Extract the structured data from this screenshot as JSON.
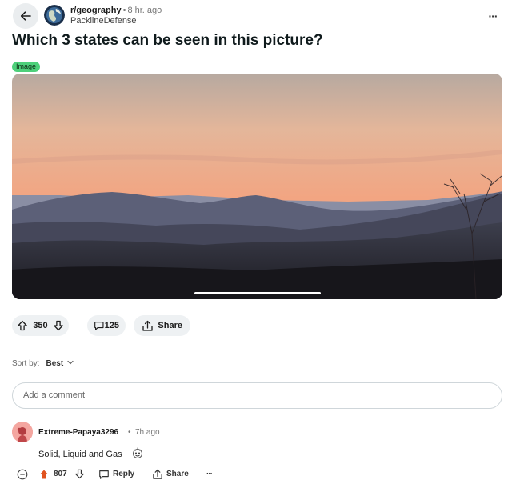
{
  "post": {
    "subreddit": "r/geography",
    "dot": "•",
    "time": "8 hr. ago",
    "author": "PacklineDefense",
    "title": "Which 3 states can be seen in this picture?",
    "flair": "Image",
    "flair_color": "#4dd07a",
    "more": "···"
  },
  "actions": {
    "votes": "350",
    "comments": "125",
    "share": "Share"
  },
  "sort": {
    "label": "Sort by:",
    "value": "Best"
  },
  "comment_box": {
    "placeholder": "Add a comment"
  },
  "comments": [
    {
      "user": "Extreme-Papaya3296",
      "dot": "•",
      "time": "7h ago",
      "text": "Solid, Liquid and Gas",
      "votes": "807",
      "reply": "Reply",
      "share": "Share",
      "more": "···"
    }
  ],
  "colors": {
    "upvote_active": "#e0531f",
    "pill_bg": "#eef1f3"
  }
}
